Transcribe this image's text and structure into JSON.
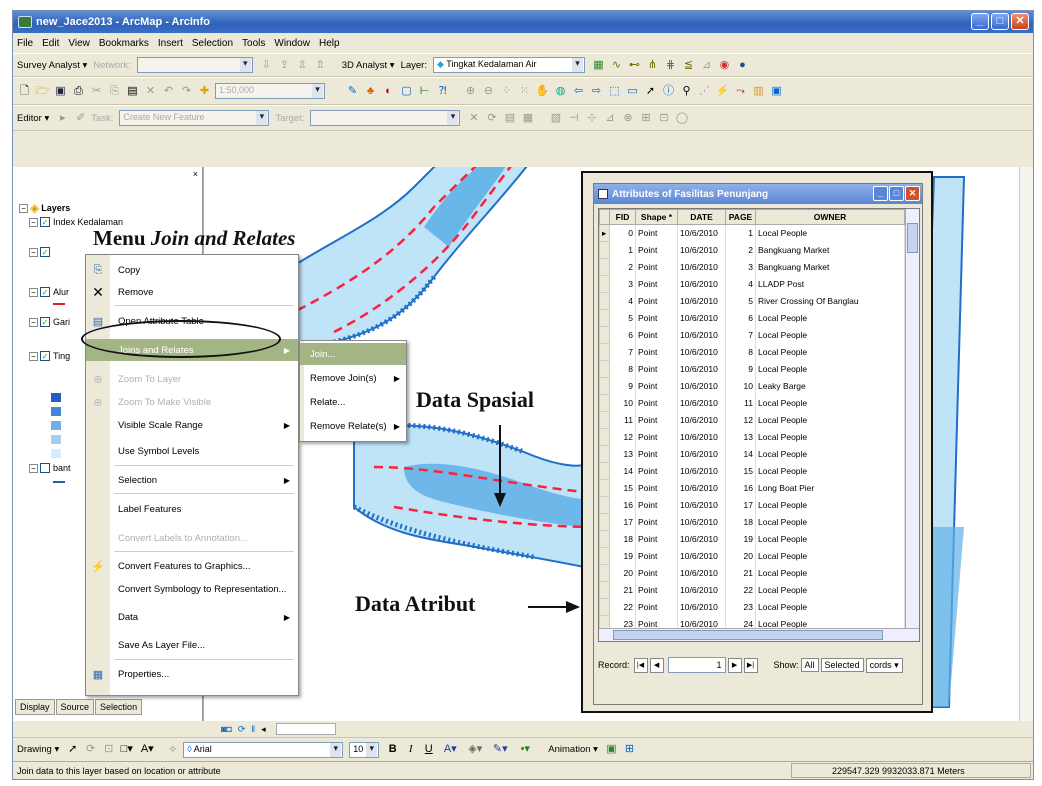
{
  "window": {
    "title": "new_Jace2013 - ArcMap - ArcInfo"
  },
  "menubar": [
    "File",
    "Edit",
    "View",
    "Bookmarks",
    "Insert",
    "Selection",
    "Tools",
    "Window",
    "Help"
  ],
  "toolbar1": {
    "survey_label": "Survey Analyst ▾",
    "network_label": "Network:",
    "analyst3d_label": "3D Analyst ▾",
    "layer_label": "Layer:",
    "layer_value": "Tingkat Kedalaman Air"
  },
  "toolbar2": {
    "scale_value": "1:50,000"
  },
  "toolbar3": {
    "editor_label": "Editor ▾",
    "task_label": "Task:",
    "task_value": "Create New Feature",
    "target_label": "Target:"
  },
  "toc": {
    "root_label": "Layers",
    "items": [
      {
        "label": "Index Kedalaman"
      },
      {
        "label": ""
      },
      {
        "label": "Alur"
      },
      {
        "label": "Gari"
      },
      {
        "label": "Ting"
      },
      {
        "label": "bant"
      }
    ],
    "tabs": [
      "Display",
      "Source",
      "Selection"
    ]
  },
  "context_menu": {
    "items": [
      {
        "label": "Copy",
        "icon": "copy-icon"
      },
      {
        "label": "Remove",
        "icon": "remove-x-icon"
      },
      {
        "label": "Open Attribute Table",
        "icon": "table-icon"
      },
      {
        "label": "Joins and Relates",
        "icon": ""
      },
      {
        "label": "Zoom To Layer",
        "icon": "zoom-layer-icon"
      },
      {
        "label": "Zoom To Make Visible",
        "icon": "zoom-visible-icon"
      },
      {
        "label": "Visible Scale Range",
        "icon": ""
      },
      {
        "label": "Use Symbol Levels",
        "icon": ""
      },
      {
        "label": "Selection",
        "icon": ""
      },
      {
        "label": "Label Features",
        "icon": ""
      },
      {
        "label": "Convert Labels to Annotation...",
        "icon": ""
      },
      {
        "label": "Convert Features to Graphics...",
        "icon": "convert-graphics-icon"
      },
      {
        "label": "Convert Symbology to Representation...",
        "icon": ""
      },
      {
        "label": "Data",
        "icon": ""
      },
      {
        "label": "Save As Layer File...",
        "icon": ""
      },
      {
        "label": "Properties...",
        "icon": "properties-icon"
      }
    ]
  },
  "submenu": {
    "items": [
      {
        "label": "Join..."
      },
      {
        "label": "Remove Join(s)"
      },
      {
        "label": "Relate..."
      },
      {
        "label": "Remove Relate(s)"
      }
    ]
  },
  "annotations": {
    "menu_prefix": "Menu",
    "menu_italic": "Join and Relates",
    "spasial": "Data Spasial",
    "atribut": "Data Atribut"
  },
  "attribute_table": {
    "title": "Attributes of Fasilitas Penunjang",
    "columns": [
      "FID",
      "Shape *",
      "DATE",
      "PAGE",
      "OWNER"
    ],
    "rows": [
      [
        "0",
        "Point",
        "10/6/2010",
        "1",
        "Local People"
      ],
      [
        "1",
        "Point",
        "10/6/2010",
        "2",
        "Bangkuang Market"
      ],
      [
        "2",
        "Point",
        "10/6/2010",
        "3",
        "Bangkuang Market"
      ],
      [
        "3",
        "Point",
        "10/6/2010",
        "4",
        "LLADP Post"
      ],
      [
        "4",
        "Point",
        "10/6/2010",
        "5",
        "River Crossing Of Banglau"
      ],
      [
        "5",
        "Point",
        "10/6/2010",
        "6",
        "Local People"
      ],
      [
        "6",
        "Point",
        "10/6/2010",
        "7",
        "Local People"
      ],
      [
        "7",
        "Point",
        "10/6/2010",
        "8",
        "Local People"
      ],
      [
        "8",
        "Point",
        "10/6/2010",
        "9",
        "Local People"
      ],
      [
        "9",
        "Point",
        "10/6/2010",
        "10",
        "Leaky Barge"
      ],
      [
        "10",
        "Point",
        "10/6/2010",
        "11",
        "Local People"
      ],
      [
        "11",
        "Point",
        "10/6/2010",
        "12",
        "Local People"
      ],
      [
        "12",
        "Point",
        "10/6/2010",
        "13",
        "Local People"
      ],
      [
        "13",
        "Point",
        "10/6/2010",
        "14",
        "Local People"
      ],
      [
        "14",
        "Point",
        "10/6/2010",
        "15",
        "Local People"
      ],
      [
        "15",
        "Point",
        "10/6/2010",
        "16",
        "Long Boat Pier"
      ],
      [
        "16",
        "Point",
        "10/6/2010",
        "17",
        "Local People"
      ],
      [
        "17",
        "Point",
        "10/6/2010",
        "18",
        "Local People"
      ],
      [
        "18",
        "Point",
        "10/6/2010",
        "19",
        "Local People"
      ],
      [
        "19",
        "Point",
        "10/6/2010",
        "20",
        "Local People"
      ],
      [
        "20",
        "Point",
        "10/6/2010",
        "21",
        "Local People"
      ],
      [
        "21",
        "Point",
        "10/6/2010",
        "22",
        "Local People"
      ],
      [
        "22",
        "Point",
        "10/6/2010",
        "23",
        "Local People"
      ],
      [
        "23",
        "Point",
        "10/6/2010",
        "24",
        "Local People"
      ]
    ],
    "record_label": "Record:",
    "record_value": "1",
    "show_label": "Show:",
    "all_label": "All",
    "selected_label": "Selected",
    "records_label": "cords ▾"
  },
  "drawing_toolbar": {
    "drawing_label": "Drawing ▾",
    "font_value": "Arial",
    "size_value": "10",
    "animation_label": "Animation ▾"
  },
  "statusbar": {
    "message": "Join data to this layer based on location or attribute",
    "coordinates": "229547.329  9932033.871 Meters"
  },
  "colors": {
    "river_light": "#bfe3f7",
    "river_mid": "#5fb0e6",
    "river_dark": "#1f6fc8",
    "highlight": "#a4b585",
    "dash_red": "#ff1f3a"
  }
}
